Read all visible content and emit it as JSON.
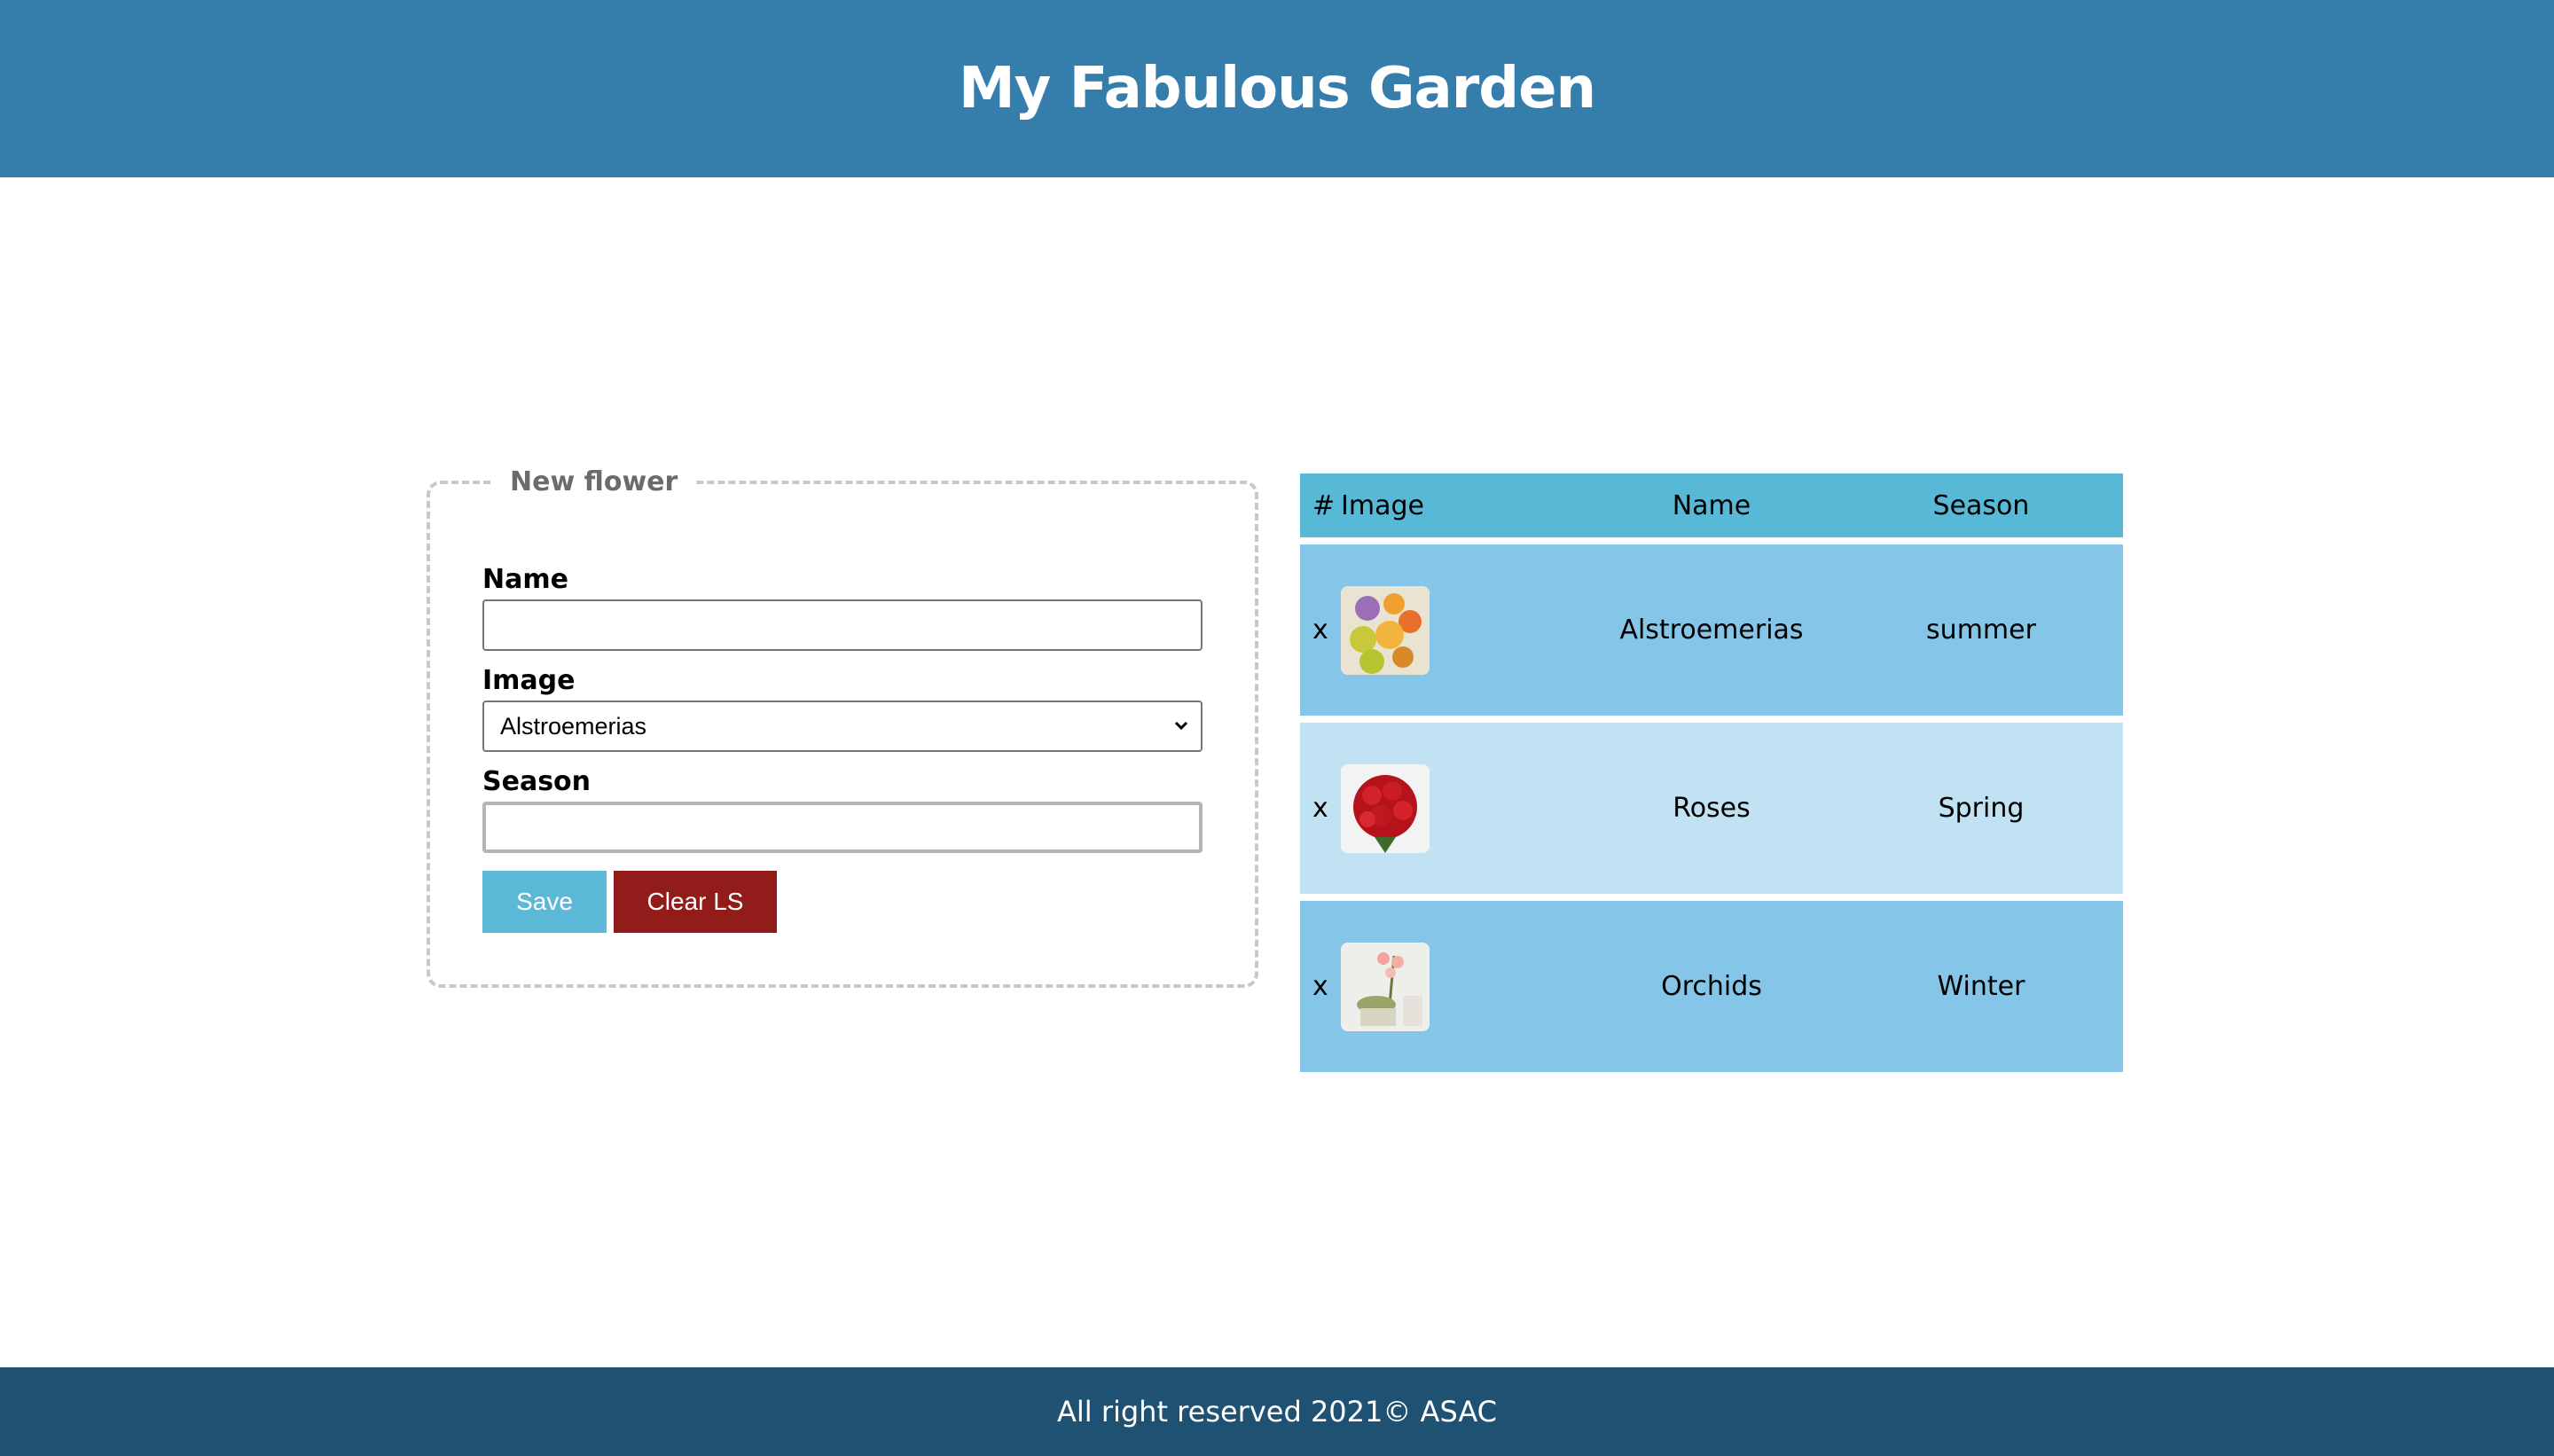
{
  "header": {
    "title": "My Fabulous Garden"
  },
  "form": {
    "legend": "New flower",
    "name_label": "Name",
    "name_value": "",
    "image_label": "Image",
    "image_selected": "Alstroemerias",
    "season_label": "Season",
    "season_value": "",
    "save_label": "Save",
    "clear_label": "Clear LS"
  },
  "table": {
    "headers": {
      "hash": "#",
      "image": "Image",
      "name": "Name",
      "season": "Season"
    },
    "rows": [
      {
        "remove": "x",
        "image_icon": "alstroemerias-photo",
        "name": "Alstroemerias",
        "season": "summer"
      },
      {
        "remove": "x",
        "image_icon": "roses-photo",
        "name": "Roses",
        "season": "Spring"
      },
      {
        "remove": "x",
        "image_icon": "orchids-photo",
        "name": "Orchids",
        "season": "Winter"
      }
    ]
  },
  "footer": {
    "text": "All right reserved 2021© ASAC"
  },
  "colors": {
    "header_bg": "#357eac",
    "footer_bg": "#1f5172",
    "table_head_bg": "#58b9d6",
    "row_bg": "#84c5e8",
    "row_alt_bg": "#c1e2f2",
    "save_bg": "#5bb8d6",
    "clear_bg": "#921c19"
  }
}
